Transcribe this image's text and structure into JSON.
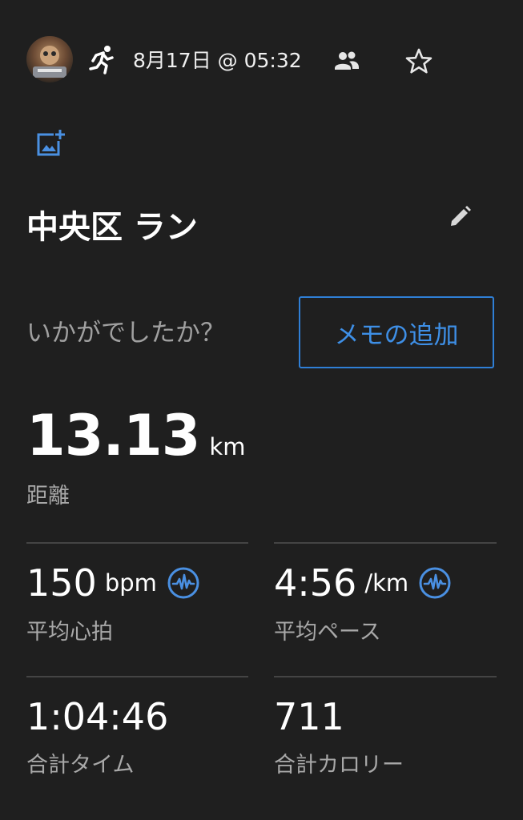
{
  "header": {
    "date_time": "8月17日 @ 05:32"
  },
  "activity": {
    "title": "中央区 ラン"
  },
  "feedback": {
    "question": "いかがでしたか？",
    "add_memo_label": "メモの追加"
  },
  "distance": {
    "value": "13.13",
    "unit": "km",
    "label": "距離"
  },
  "stats": [
    {
      "value": "150",
      "unit": "bpm",
      "label": "平均心拍",
      "has_chart_icon": true
    },
    {
      "value": "4:56",
      "unit": "/km",
      "label": "平均ペース",
      "has_chart_icon": true
    },
    {
      "value": "1:04:46",
      "unit": "",
      "label": "合計タイム",
      "has_chart_icon": false
    },
    {
      "value": "711",
      "unit": "",
      "label": "合計カロリー",
      "has_chart_icon": false
    }
  ],
  "colors": {
    "background": "#1f1f1f",
    "accent": "#2f7fd6",
    "icon_blue": "#4a90e2",
    "secondary_text": "#a8a8a8",
    "divider": "#444444"
  },
  "icons": {
    "activity": "running-icon",
    "people": "people-icon",
    "favorite": "star-icon",
    "add_photo": "add-photo-icon",
    "edit": "pencil-icon",
    "chart": "activity-chart-icon"
  }
}
